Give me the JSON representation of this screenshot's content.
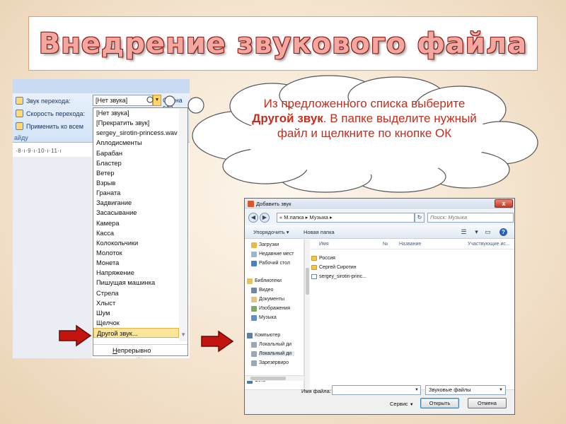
{
  "slide": {
    "title": "Внедрение звукового файла",
    "callout": {
      "text_before": "Из предложенного списка выберите ",
      "text_bold": "Другой звук",
      "text_after": ". В папке выделите нужный файл и щелкните по кнопке ОК"
    },
    "colors": {
      "title_fill": "#f2a8a0",
      "title_outline": "#8c1a12",
      "callout_text": "#c62d1c",
      "arrow": "#c2150f"
    }
  },
  "ppt": {
    "ribbon": {
      "sound_label": "Звук перехода:",
      "speed_label": "Скорость перехода:",
      "apply_all_label": "Применить ко всем",
      "group_footer": "айду",
      "sound_value": "[Нет звука]",
      "right_fragment": "Смена сла"
    },
    "ruler": "·8·ı·9·ı·10·ı·11·ı",
    "sound_list": [
      "[Нет звука]",
      "[Прекратить звук]",
      "sergey_sirotin-princess.wav",
      "Аплодисменты",
      "Барабан",
      "Бластер",
      "Ветер",
      "Взрыв",
      "Граната",
      "Задвигание",
      "Засасывание",
      "Камера",
      "Касса",
      "Колокольчики",
      "Молоток",
      "Монета",
      "Напряжение",
      "Пишущая машинка",
      "Стрела",
      "Хлыст",
      "Шум",
      "Щелчок",
      "Другой звук..."
    ],
    "selected_item": "Другой звук...",
    "loop_option": {
      "underlined": "Н",
      "rest": "епрерывно"
    },
    "dots": "····"
  },
  "dialog": {
    "title": "Добавить звук",
    "close": "x",
    "breadcrumb": "«  М.папка  ▸  Музыка  ▸",
    "search_placeholder": "Поиск: Музыка",
    "toolbar": {
      "organize": "Упорядочить ▾",
      "new_folder": "Новая папка"
    },
    "nav": {
      "favorites": [
        "Загрузки",
        "Недавние мест",
        "Рабочий стол"
      ],
      "libraries_header": "Библиотеки",
      "libraries": [
        "Видео",
        "Документы",
        "Изображения",
        "Музыка"
      ],
      "computer_header": "Компьютер",
      "computer": [
        "Локальный ди",
        "Локальный ди",
        "Зарезервиро"
      ],
      "network": "Сеть"
    },
    "columns": {
      "name": "Имя",
      "num": "№",
      "title": "Название",
      "artists": "Участвующие ис..."
    },
    "files": [
      "Россия",
      "Сергей Сиротин",
      "sergey_sirotin-princ..."
    ],
    "filename_label": "Имя файла:",
    "filetype": "Звуковые файлы",
    "service": "Сервис",
    "open": "Открыть",
    "cancel": "Отмена"
  }
}
